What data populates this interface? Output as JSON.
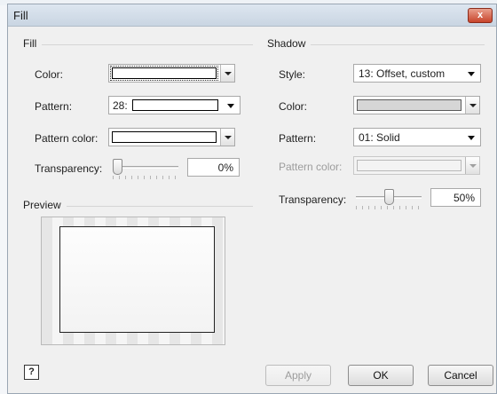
{
  "dialog": {
    "title": "Fill",
    "close_label": "x"
  },
  "fill": {
    "group_title": "Fill",
    "color_label": "Color:",
    "pattern_label": "Pattern:",
    "pattern_value": "28:",
    "pattern_color_label": "Pattern color:",
    "transparency_label": "Transparency:",
    "transparency_value": "0%",
    "transparency_fraction": 0.0
  },
  "shadow": {
    "group_title": "Shadow",
    "style_label": "Style:",
    "style_value": "13: Offset, custom",
    "color_label": "Color:",
    "pattern_label": "Pattern:",
    "pattern_value": "01: Solid",
    "pattern_color_label": "Pattern color:",
    "transparency_label": "Transparency:",
    "transparency_value": "50%",
    "transparency_fraction": 0.5
  },
  "preview": {
    "group_title": "Preview"
  },
  "buttons": {
    "help": "?",
    "apply": "Apply",
    "ok": "OK",
    "cancel": "Cancel"
  },
  "icons": {
    "close": "close-icon",
    "help": "help-icon",
    "dropdown": "chevron-down-icon"
  }
}
